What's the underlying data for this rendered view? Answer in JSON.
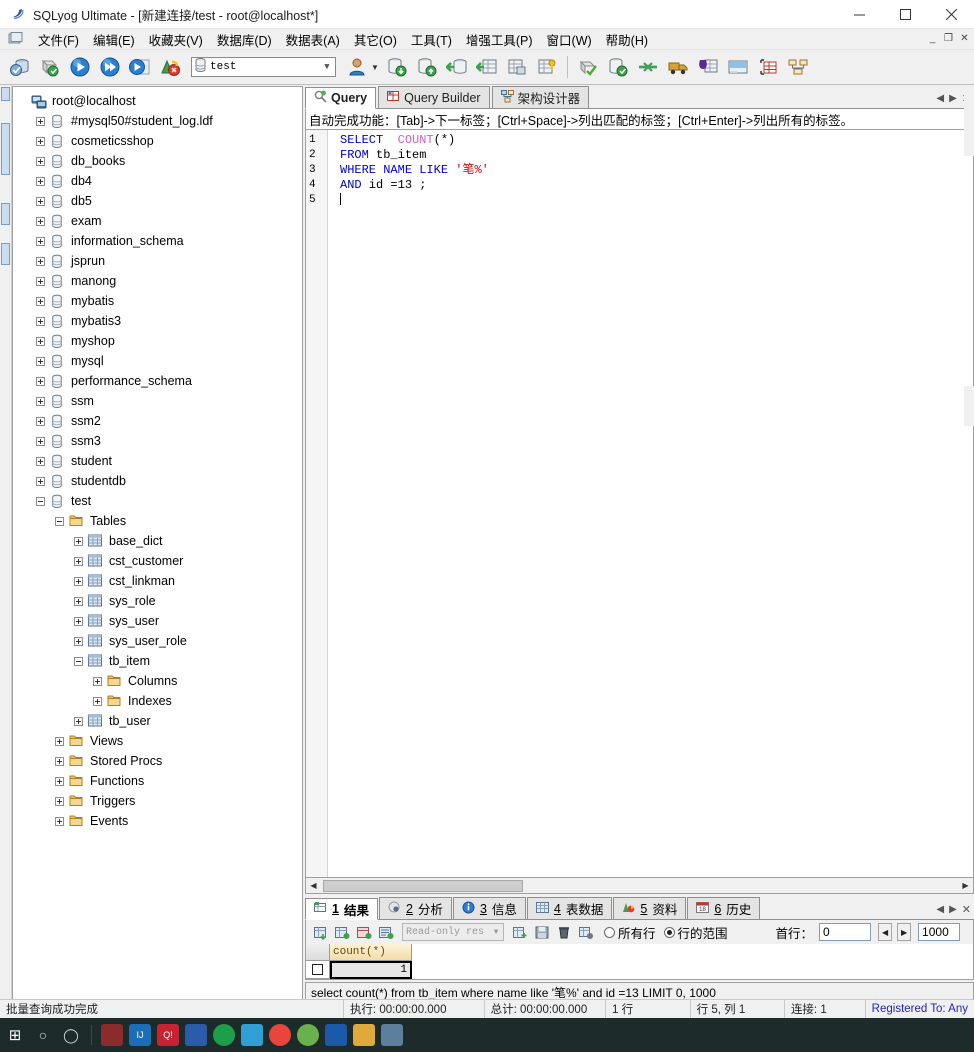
{
  "window": {
    "title": "SQLyog Ultimate - [新建连接/test - root@localhost*]",
    "app_icon": "sqlyog-icon",
    "minimize": "–",
    "maximize": "□",
    "close": "✕"
  },
  "menubar": {
    "doc_icon": "document-icon",
    "items": [
      {
        "label": "文件(F)",
        "name": "menu-file"
      },
      {
        "label": "编辑(E)",
        "name": "menu-edit"
      },
      {
        "label": "收藏夹(V)",
        "name": "menu-favorites"
      },
      {
        "label": "数据库(D)",
        "name": "menu-database"
      },
      {
        "label": "数据表(A)",
        "name": "menu-table"
      },
      {
        "label": "其它(O)",
        "name": "menu-other"
      },
      {
        "label": "工具(T)",
        "name": "menu-tools"
      },
      {
        "label": "增强工具(P)",
        "name": "menu-powertools"
      },
      {
        "label": "窗口(W)",
        "name": "menu-window"
      },
      {
        "label": "帮助(H)",
        "name": "menu-help"
      }
    ],
    "mdi_minimize": "_",
    "mdi_restore": "❐",
    "mdi_close": "✕"
  },
  "toolbar": {
    "db_selector": {
      "value": "test",
      "icon": "database-icon",
      "arrow": "▼"
    },
    "user_arrow": "▼",
    "buttons": [
      {
        "name": "new-connection-button",
        "icon": "connection-icon"
      },
      {
        "name": "refresh-object-browser-button",
        "icon": "refresh-icon"
      },
      {
        "name": "execute-query-button",
        "icon": "play-icon"
      },
      {
        "name": "execute-all-queries-button",
        "icon": "play-all-icon"
      },
      {
        "name": "execute-query-new-tab-button",
        "icon": "play-newtab-icon"
      },
      {
        "name": "stop-query-button",
        "icon": "stop-icon"
      },
      {
        "name": "user-manager-button",
        "icon": "user-icon"
      },
      {
        "name": "import-external-data-button",
        "icon": "db-import-icon"
      },
      {
        "name": "export-data-button",
        "icon": "db-export-icon"
      },
      {
        "name": "backup-database-button",
        "icon": "db-backup-icon"
      },
      {
        "name": "restore-database-button",
        "icon": "db-restore-icon"
      },
      {
        "name": "table-diagnostics-button",
        "icon": "table-tools-icon"
      },
      {
        "name": "manage-indexes-button",
        "icon": "index-icon"
      },
      {
        "name": "tools-button",
        "icon": "wand-icon"
      },
      {
        "name": "schema-sync-button",
        "icon": "sync-icon"
      },
      {
        "name": "data-sync-button",
        "icon": "data-sync-icon"
      },
      {
        "name": "migration-button",
        "icon": "truck-icon"
      },
      {
        "name": "notification-services-button",
        "icon": "notify-icon"
      },
      {
        "name": "sql-formatter-button",
        "icon": "format-icon"
      },
      {
        "name": "query-builder-button",
        "icon": "grid-icon"
      },
      {
        "name": "schema-designer-button",
        "icon": "designer-icon"
      }
    ]
  },
  "tree": {
    "root": {
      "label": "root@localhost",
      "icon": "server-icon"
    },
    "nodes": [
      {
        "label": "#mysql50#student_log.ldf",
        "indent": 1,
        "icon": "database-icon",
        "state": "plus"
      },
      {
        "label": "cosmeticsshop",
        "indent": 1,
        "icon": "database-icon",
        "state": "plus"
      },
      {
        "label": "db_books",
        "indent": 1,
        "icon": "database-icon",
        "state": "plus"
      },
      {
        "label": "db4",
        "indent": 1,
        "icon": "database-icon",
        "state": "plus"
      },
      {
        "label": "db5",
        "indent": 1,
        "icon": "database-icon",
        "state": "plus"
      },
      {
        "label": "exam",
        "indent": 1,
        "icon": "database-icon",
        "state": "plus"
      },
      {
        "label": "information_schema",
        "indent": 1,
        "icon": "database-icon",
        "state": "plus"
      },
      {
        "label": "jsprun",
        "indent": 1,
        "icon": "database-icon",
        "state": "plus"
      },
      {
        "label": "manong",
        "indent": 1,
        "icon": "database-icon",
        "state": "plus"
      },
      {
        "label": "mybatis",
        "indent": 1,
        "icon": "database-icon",
        "state": "plus"
      },
      {
        "label": "mybatis3",
        "indent": 1,
        "icon": "database-icon",
        "state": "plus"
      },
      {
        "label": "myshop",
        "indent": 1,
        "icon": "database-icon",
        "state": "plus"
      },
      {
        "label": "mysql",
        "indent": 1,
        "icon": "database-icon",
        "state": "plus"
      },
      {
        "label": "performance_schema",
        "indent": 1,
        "icon": "database-icon",
        "state": "plus"
      },
      {
        "label": "ssm",
        "indent": 1,
        "icon": "database-icon",
        "state": "plus"
      },
      {
        "label": "ssm2",
        "indent": 1,
        "icon": "database-icon",
        "state": "plus"
      },
      {
        "label": "ssm3",
        "indent": 1,
        "icon": "database-icon",
        "state": "plus"
      },
      {
        "label": "student",
        "indent": 1,
        "icon": "database-icon",
        "state": "plus"
      },
      {
        "label": "studentdb",
        "indent": 1,
        "icon": "database-icon",
        "state": "plus"
      },
      {
        "label": "test",
        "indent": 1,
        "icon": "database-icon",
        "state": "minus"
      },
      {
        "label": "Tables",
        "indent": 2,
        "icon": "folder-icon",
        "state": "minus"
      },
      {
        "label": "base_dict",
        "indent": 3,
        "icon": "table-icon",
        "state": "plus"
      },
      {
        "label": "cst_customer",
        "indent": 3,
        "icon": "table-icon",
        "state": "plus"
      },
      {
        "label": "cst_linkman",
        "indent": 3,
        "icon": "table-icon",
        "state": "plus"
      },
      {
        "label": "sys_role",
        "indent": 3,
        "icon": "table-icon",
        "state": "plus"
      },
      {
        "label": "sys_user",
        "indent": 3,
        "icon": "table-icon",
        "state": "plus"
      },
      {
        "label": "sys_user_role",
        "indent": 3,
        "icon": "table-icon",
        "state": "plus"
      },
      {
        "label": "tb_item",
        "indent": 3,
        "icon": "table-icon",
        "state": "minus"
      },
      {
        "label": "Columns",
        "indent": 4,
        "icon": "folder-icon",
        "state": "plus"
      },
      {
        "label": "Indexes",
        "indent": 4,
        "icon": "folder-icon",
        "state": "plus"
      },
      {
        "label": "tb_user",
        "indent": 3,
        "icon": "table-icon",
        "state": "plus"
      },
      {
        "label": "Views",
        "indent": 2,
        "icon": "folder-icon",
        "state": "plus"
      },
      {
        "label": "Stored Procs",
        "indent": 2,
        "icon": "folder-icon",
        "state": "plus"
      },
      {
        "label": "Functions",
        "indent": 2,
        "icon": "folder-icon",
        "state": "plus"
      },
      {
        "label": "Triggers",
        "indent": 2,
        "icon": "folder-icon",
        "state": "plus"
      },
      {
        "label": "Events",
        "indent": 2,
        "icon": "folder-icon",
        "state": "plus"
      }
    ]
  },
  "editor": {
    "tabs": [
      {
        "label": "Query",
        "icon": "query-icon",
        "active": true,
        "name": "tab-query"
      },
      {
        "label": "Query Builder",
        "icon": "query-builder-icon",
        "active": false,
        "name": "tab-query-builder"
      },
      {
        "label": "架构设计器",
        "icon": "schema-designer-icon",
        "active": false,
        "name": "tab-schema-designer"
      }
    ],
    "hint": "自动完成功能：[Tab]->下一标签；[Ctrl+Space]->列出匹配的标签；[Ctrl+Enter]->列出所有的标签。",
    "line_numbers": [
      "1",
      "2",
      "3",
      "4",
      "5"
    ],
    "sql_lines": [
      [
        {
          "t": "SELECT",
          "c": "kw"
        },
        {
          "t": "  ",
          "c": "pl"
        },
        {
          "t": "COUNT",
          "c": "fn"
        },
        {
          "t": "(*)",
          "c": "pl"
        }
      ],
      [
        {
          "t": "FROM",
          "c": "kw"
        },
        {
          "t": " tb_item",
          "c": "pl"
        }
      ],
      [
        {
          "t": "WHERE",
          "c": "kw"
        },
        {
          "t": " ",
          "c": "pl"
        },
        {
          "t": "NAME",
          "c": "kw"
        },
        {
          "t": " ",
          "c": "pl"
        },
        {
          "t": "LIKE",
          "c": "kw"
        },
        {
          "t": " ",
          "c": "pl"
        },
        {
          "t": "'笔%'",
          "c": "str"
        }
      ],
      [
        {
          "t": "AND",
          "c": "kw"
        },
        {
          "t": " id =13 ;",
          "c": "pl"
        }
      ],
      []
    ],
    "scroll_left_arrow": "◀",
    "scroll_right_arrow": "▶"
  },
  "results": {
    "tabs": [
      {
        "num": "1",
        "label": "结果",
        "icon": "result-grid-icon",
        "active": true,
        "name": "tab-result"
      },
      {
        "num": "2",
        "label": "分析",
        "icon": "profiler-icon",
        "active": false,
        "name": "tab-profiler"
      },
      {
        "num": "3",
        "label": "信息",
        "icon": "info-icon",
        "active": false,
        "name": "tab-messages"
      },
      {
        "num": "4",
        "label": "表数据",
        "icon": "table-data-icon",
        "active": false,
        "name": "tab-table-data"
      },
      {
        "num": "5",
        "label": "资料",
        "icon": "objects-icon",
        "active": false,
        "name": "tab-objects"
      },
      {
        "num": "6",
        "label": "历史",
        "icon": "history-icon",
        "active": false,
        "name": "tab-history"
      }
    ],
    "toolbar": {
      "mode_selector_value": "Read-only res",
      "mode_selector_arrow": "▼",
      "buttons": [
        {
          "name": "refresh-data-button",
          "icon": "refresh-grid-icon"
        },
        {
          "name": "grid-view-button",
          "icon": "grid-view-icon"
        },
        {
          "name": "form-view-button",
          "icon": "form-view-icon"
        },
        {
          "name": "text-view-button",
          "icon": "text-view-icon"
        },
        {
          "name": "insert-row-button",
          "icon": "insert-row-icon"
        },
        {
          "name": "save-changes-button",
          "icon": "save-icon"
        },
        {
          "name": "delete-row-button",
          "icon": "trash-icon"
        },
        {
          "name": "copy-row-button",
          "icon": "copy-row-icon"
        }
      ],
      "radio_all_rows": "所有行",
      "radio_row_range": "行的范围",
      "selected_radio": "行的范围",
      "first_row_label": "首行：",
      "first_row_value": "0",
      "limit_value": "1000",
      "prev_arrow": "◀",
      "next_arrow": "▶"
    },
    "grid": {
      "columns": [
        "count(*)"
      ],
      "rows": [
        [
          "1"
        ]
      ]
    },
    "executed_sql": "select  count(*) from tb_item where name like '笔%' and id =13  LIMIT 0, 1000"
  },
  "statusbar": {
    "segments": [
      {
        "text": "批量查询成功完成",
        "name": "status-message"
      },
      {
        "text": "执行: 00:00:00.000",
        "name": "status-exec-time"
      },
      {
        "text": "总计: 00:00:00.000",
        "name": "status-total-time"
      },
      {
        "text": "1 行",
        "name": "status-row-count"
      },
      {
        "text": "行 5, 列 1",
        "name": "status-cursor-pos"
      },
      {
        "text": "连接: 1",
        "name": "status-connections"
      }
    ],
    "registration": "Registered To: Any"
  },
  "taskbar": {
    "items": [
      {
        "name": "taskbar-start",
        "glyph": "⊞",
        "color": "#ffffff",
        "bg": "transparent"
      },
      {
        "name": "taskbar-search",
        "glyph": "○",
        "color": "#dddddd",
        "bg": "transparent"
      },
      {
        "name": "taskbar-cortana",
        "glyph": "◯",
        "color": "#dddddd",
        "bg": "transparent"
      },
      {
        "name": "taskbar-app-1",
        "glyph": "",
        "color": "#ffffff",
        "bg": "#8b2b2b"
      },
      {
        "name": "taskbar-idea",
        "glyph": "IJ",
        "color": "#ffffff",
        "bg": "#1b6fb8"
      },
      {
        "name": "taskbar-qq",
        "glyph": "Q!",
        "color": "#ffffff",
        "bg": "#c82333"
      },
      {
        "name": "taskbar-app-2",
        "glyph": "",
        "color": "#ffffff",
        "bg": "#2a5caa"
      },
      {
        "name": "taskbar-app-3",
        "glyph": "",
        "color": "#ffffff",
        "bg": "#1d9e4a"
      },
      {
        "name": "taskbar-app-4",
        "glyph": "",
        "color": "#ffffff",
        "bg": "#2f9fd4"
      },
      {
        "name": "taskbar-chrome",
        "glyph": "",
        "color": "#ffffff",
        "bg": "#e8453c"
      },
      {
        "name": "taskbar-app-5",
        "glyph": "",
        "color": "#ffffff",
        "bg": "#6ab04c"
      },
      {
        "name": "taskbar-app-6",
        "glyph": "",
        "color": "#ffffff",
        "bg": "#1b5aa8"
      },
      {
        "name": "taskbar-folder",
        "glyph": "",
        "color": "#ffffff",
        "bg": "#e0a93b"
      },
      {
        "name": "taskbar-recycle-bin",
        "glyph": "",
        "color": "#ffffff",
        "bg": "#5d7f9e"
      }
    ]
  },
  "colors": {
    "keyword": "#0000d0",
    "function": "#d060c0",
    "string": "#d00000",
    "header_gold": "#f3dca8",
    "registered_blue": "#2222cc"
  }
}
